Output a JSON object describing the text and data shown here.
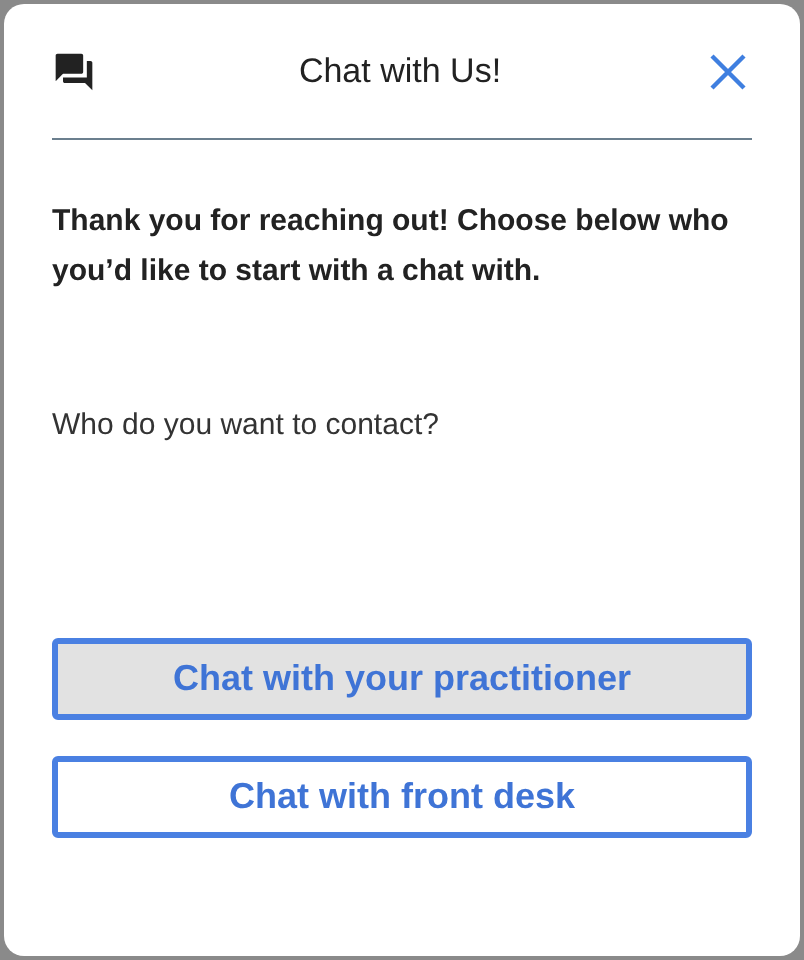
{
  "dialog": {
    "title": "Chat with Us!",
    "intro": "Thank you for reaching out! Choose below who you’d like to start with a chat with.",
    "question": "Who do you want to contact?",
    "options": [
      {
        "label": "Chat with your practitioner",
        "selected": true
      },
      {
        "label": "Chat with front desk",
        "selected": false
      }
    ]
  }
}
